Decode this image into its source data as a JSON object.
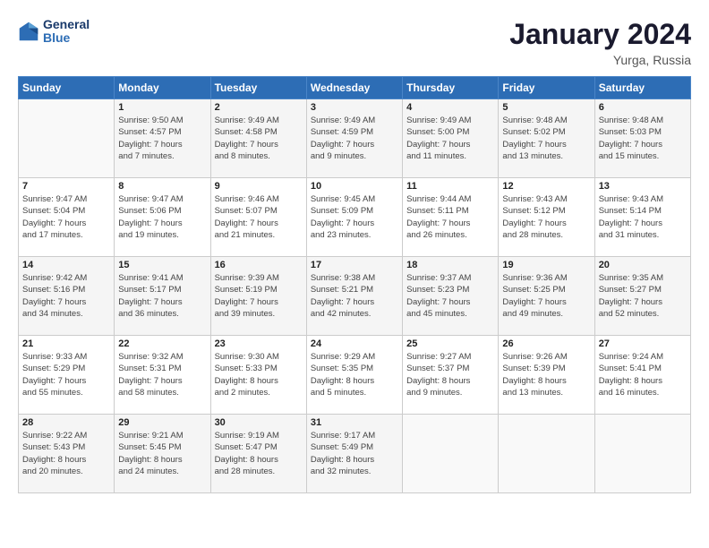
{
  "header": {
    "logo_line1": "General",
    "logo_line2": "Blue",
    "month_title": "January 2024",
    "location": "Yurga, Russia"
  },
  "weekdays": [
    "Sunday",
    "Monday",
    "Tuesday",
    "Wednesday",
    "Thursday",
    "Friday",
    "Saturday"
  ],
  "weeks": [
    [
      {
        "day": "",
        "info": ""
      },
      {
        "day": "1",
        "info": "Sunrise: 9:50 AM\nSunset: 4:57 PM\nDaylight: 7 hours\nand 7 minutes."
      },
      {
        "day": "2",
        "info": "Sunrise: 9:49 AM\nSunset: 4:58 PM\nDaylight: 7 hours\nand 8 minutes."
      },
      {
        "day": "3",
        "info": "Sunrise: 9:49 AM\nSunset: 4:59 PM\nDaylight: 7 hours\nand 9 minutes."
      },
      {
        "day": "4",
        "info": "Sunrise: 9:49 AM\nSunset: 5:00 PM\nDaylight: 7 hours\nand 11 minutes."
      },
      {
        "day": "5",
        "info": "Sunrise: 9:48 AM\nSunset: 5:02 PM\nDaylight: 7 hours\nand 13 minutes."
      },
      {
        "day": "6",
        "info": "Sunrise: 9:48 AM\nSunset: 5:03 PM\nDaylight: 7 hours\nand 15 minutes."
      }
    ],
    [
      {
        "day": "7",
        "info": "Sunrise: 9:47 AM\nSunset: 5:04 PM\nDaylight: 7 hours\nand 17 minutes."
      },
      {
        "day": "8",
        "info": "Sunrise: 9:47 AM\nSunset: 5:06 PM\nDaylight: 7 hours\nand 19 minutes."
      },
      {
        "day": "9",
        "info": "Sunrise: 9:46 AM\nSunset: 5:07 PM\nDaylight: 7 hours\nand 21 minutes."
      },
      {
        "day": "10",
        "info": "Sunrise: 9:45 AM\nSunset: 5:09 PM\nDaylight: 7 hours\nand 23 minutes."
      },
      {
        "day": "11",
        "info": "Sunrise: 9:44 AM\nSunset: 5:11 PM\nDaylight: 7 hours\nand 26 minutes."
      },
      {
        "day": "12",
        "info": "Sunrise: 9:43 AM\nSunset: 5:12 PM\nDaylight: 7 hours\nand 28 minutes."
      },
      {
        "day": "13",
        "info": "Sunrise: 9:43 AM\nSunset: 5:14 PM\nDaylight: 7 hours\nand 31 minutes."
      }
    ],
    [
      {
        "day": "14",
        "info": "Sunrise: 9:42 AM\nSunset: 5:16 PM\nDaylight: 7 hours\nand 34 minutes."
      },
      {
        "day": "15",
        "info": "Sunrise: 9:41 AM\nSunset: 5:17 PM\nDaylight: 7 hours\nand 36 minutes."
      },
      {
        "day": "16",
        "info": "Sunrise: 9:39 AM\nSunset: 5:19 PM\nDaylight: 7 hours\nand 39 minutes."
      },
      {
        "day": "17",
        "info": "Sunrise: 9:38 AM\nSunset: 5:21 PM\nDaylight: 7 hours\nand 42 minutes."
      },
      {
        "day": "18",
        "info": "Sunrise: 9:37 AM\nSunset: 5:23 PM\nDaylight: 7 hours\nand 45 minutes."
      },
      {
        "day": "19",
        "info": "Sunrise: 9:36 AM\nSunset: 5:25 PM\nDaylight: 7 hours\nand 49 minutes."
      },
      {
        "day": "20",
        "info": "Sunrise: 9:35 AM\nSunset: 5:27 PM\nDaylight: 7 hours\nand 52 minutes."
      }
    ],
    [
      {
        "day": "21",
        "info": "Sunrise: 9:33 AM\nSunset: 5:29 PM\nDaylight: 7 hours\nand 55 minutes."
      },
      {
        "day": "22",
        "info": "Sunrise: 9:32 AM\nSunset: 5:31 PM\nDaylight: 7 hours\nand 58 minutes."
      },
      {
        "day": "23",
        "info": "Sunrise: 9:30 AM\nSunset: 5:33 PM\nDaylight: 8 hours\nand 2 minutes."
      },
      {
        "day": "24",
        "info": "Sunrise: 9:29 AM\nSunset: 5:35 PM\nDaylight: 8 hours\nand 5 minutes."
      },
      {
        "day": "25",
        "info": "Sunrise: 9:27 AM\nSunset: 5:37 PM\nDaylight: 8 hours\nand 9 minutes."
      },
      {
        "day": "26",
        "info": "Sunrise: 9:26 AM\nSunset: 5:39 PM\nDaylight: 8 hours\nand 13 minutes."
      },
      {
        "day": "27",
        "info": "Sunrise: 9:24 AM\nSunset: 5:41 PM\nDaylight: 8 hours\nand 16 minutes."
      }
    ],
    [
      {
        "day": "28",
        "info": "Sunrise: 9:22 AM\nSunset: 5:43 PM\nDaylight: 8 hours\nand 20 minutes."
      },
      {
        "day": "29",
        "info": "Sunrise: 9:21 AM\nSunset: 5:45 PM\nDaylight: 8 hours\nand 24 minutes."
      },
      {
        "day": "30",
        "info": "Sunrise: 9:19 AM\nSunset: 5:47 PM\nDaylight: 8 hours\nand 28 minutes."
      },
      {
        "day": "31",
        "info": "Sunrise: 9:17 AM\nSunset: 5:49 PM\nDaylight: 8 hours\nand 32 minutes."
      },
      {
        "day": "",
        "info": ""
      },
      {
        "day": "",
        "info": ""
      },
      {
        "day": "",
        "info": ""
      }
    ]
  ]
}
